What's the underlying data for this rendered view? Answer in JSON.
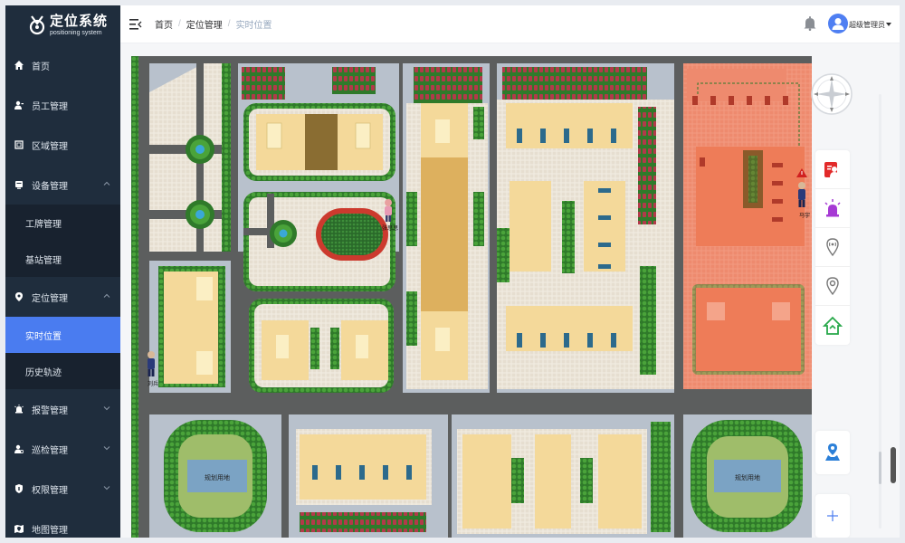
{
  "app": {
    "logo_title": "定位系统",
    "logo_subtitle": "positioning system"
  },
  "sidebar": {
    "items": [
      {
        "label": "首页",
        "icon": "home-icon"
      },
      {
        "label": "员工管理",
        "icon": "user-icon"
      },
      {
        "label": "区域管理",
        "icon": "area-icon"
      },
      {
        "label": "设备管理",
        "icon": "device-icon",
        "expanded": true
      },
      {
        "label": "定位管理",
        "icon": "location-icon",
        "expanded": true
      },
      {
        "label": "报警管理",
        "icon": "alarm-icon"
      },
      {
        "label": "巡检管理",
        "icon": "patrol-icon"
      },
      {
        "label": "权限管理",
        "icon": "shield-icon"
      },
      {
        "label": "地图管理",
        "icon": "map-icon"
      }
    ],
    "device_sub": [
      "工牌管理",
      "基站管理"
    ],
    "location_sub": [
      "实时位置",
      "历史轨迹"
    ],
    "active": "实时位置"
  },
  "header": {
    "breadcrumb": [
      "首页",
      "定位管理",
      "实时位置"
    ],
    "user_name": "超级管理员"
  },
  "map": {
    "markers": [
      {
        "name": "张思思",
        "role": "worker"
      },
      {
        "name": "刘兵",
        "role": "guard"
      },
      {
        "name": "马宇",
        "role": "guard",
        "alarm": true
      }
    ],
    "zones": [
      "规划用地",
      "规划用地"
    ]
  },
  "colors": {
    "sidebar_bg": "#1f2d3d",
    "active_bg": "#4a7cf0",
    "alarm_zone": "#f08a6c",
    "road": "#5c5e5e"
  },
  "rightbar": {
    "tools": [
      "compass-icon",
      "badge-icon",
      "alarm-light-icon",
      "base-station-icon",
      "location-pin-icon",
      "home-zone-icon",
      "person-pin-icon",
      "plus-icon"
    ]
  }
}
